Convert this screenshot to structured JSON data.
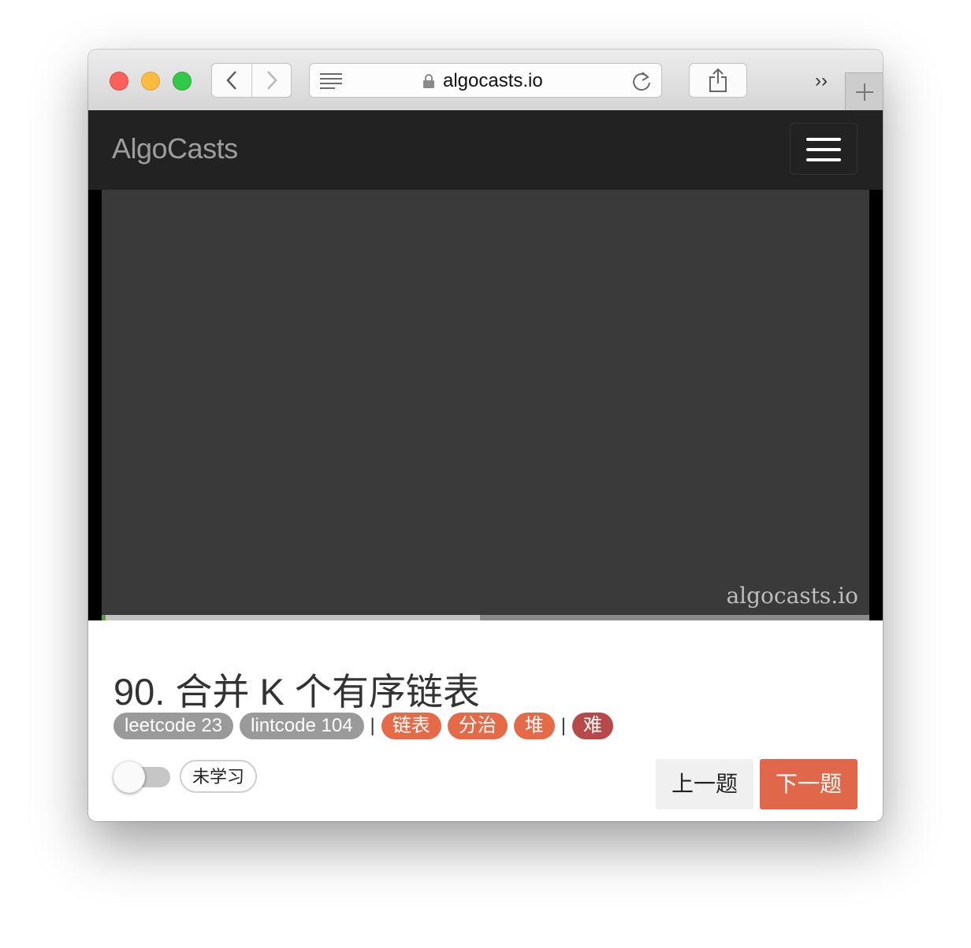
{
  "browser": {
    "url": "algocasts.io"
  },
  "site": {
    "brand": "AlgoCasts"
  },
  "video": {
    "watermark": "algocasts.io",
    "played_fraction": 0.005,
    "buffered_fraction": 0.493
  },
  "problem": {
    "title": "90. 合并 K 个有序链表",
    "sources": [
      "leetcode 23",
      "lintcode 104"
    ],
    "separator": "|",
    "topics": [
      "链表",
      "分治",
      "堆"
    ],
    "difficulty": "难"
  },
  "study": {
    "status": "未学习",
    "learned": false
  },
  "pager": {
    "prev_label": "上一题",
    "next_label": "下一题"
  },
  "colors": {
    "navbar": "#222222",
    "topic_tag": "#e56a48",
    "difficulty_tag": "#b7494a",
    "source_tag": "#9a9a9a",
    "next_button": "#e0674a"
  }
}
